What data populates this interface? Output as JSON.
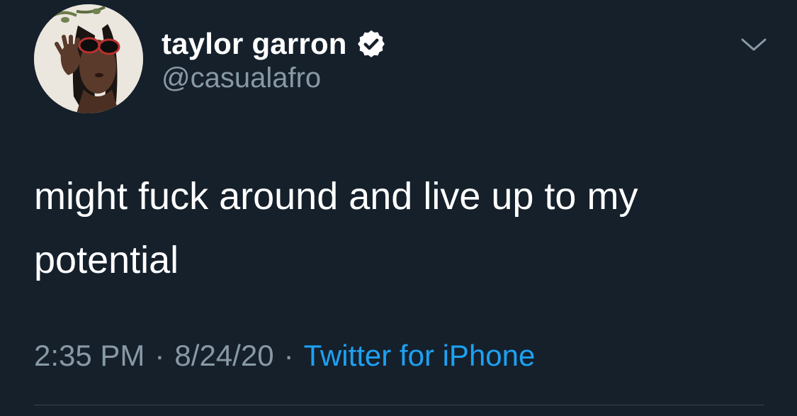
{
  "tweet": {
    "author": {
      "display_name": "taylor garron",
      "handle": "@casualafro",
      "verified": true
    },
    "text": "might fuck around and live up to my potential",
    "time": "2:35 PM",
    "separator": "·",
    "date": "8/24/20",
    "source": "Twitter for iPhone"
  },
  "icons": {
    "verified": "verified-badge-icon",
    "menu": "chevron-down-icon"
  },
  "colors": {
    "background": "#15202b",
    "primary_text": "#ffffff",
    "secondary_text": "#8899a6",
    "link": "#1da1f2",
    "divider": "#38444d"
  }
}
